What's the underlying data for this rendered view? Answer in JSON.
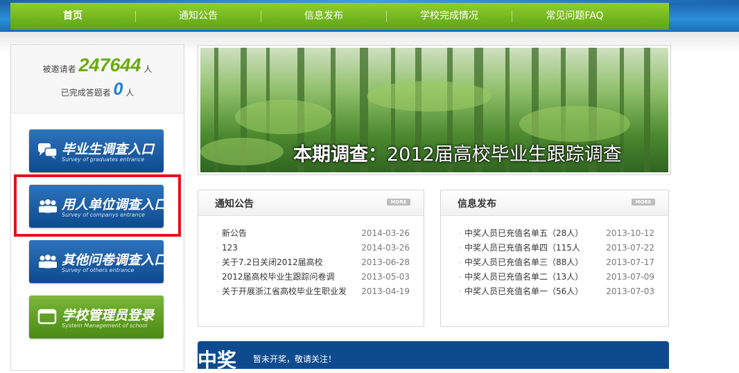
{
  "nav": {
    "items": [
      "首页",
      "通知公告",
      "信息发布",
      "学校完成情况",
      "常见问题FAQ"
    ],
    "active": "首页"
  },
  "stats": {
    "invited_label": "被邀请者",
    "invited_count": "247644",
    "invited_unit": "人",
    "completed_label": "已完成答题者",
    "completed_count": "0",
    "completed_unit": "人"
  },
  "entries": [
    {
      "title": "毕业生调查入口",
      "subtitle": "Survey of graduates entrance",
      "icon": "chat-bubbles-icon"
    },
    {
      "title": "用人单位调查入口",
      "subtitle": "Survey of companys entrance",
      "icon": "people-group-icon"
    },
    {
      "title": "其他问卷调查入口",
      "subtitle": "Survey of others entrance",
      "icon": "people-group-icon"
    },
    {
      "title": "学校管理员登录",
      "subtitle": "System Management of school",
      "icon": "window-icon"
    }
  ],
  "banner": {
    "prefix": "本期调查：",
    "title": "2012届高校毕业生跟踪调查"
  },
  "notice_panel": {
    "title": "通知公告",
    "more": "MORE",
    "items": [
      {
        "text": "新公告",
        "date": "2014-03-26"
      },
      {
        "text": "123",
        "date": "2014-03-26"
      },
      {
        "text": "关于7.2日关闭2012届高校",
        "date": "2013-06-28"
      },
      {
        "text": "2012届高校毕业生跟踪问卷调",
        "date": "2013-05-03"
      },
      {
        "text": "关于开展浙江省高校毕业生职业发",
        "date": "2013-04-19"
      }
    ]
  },
  "info_panel": {
    "title": "信息发布",
    "more": "MORE",
    "items": [
      {
        "text": "中奖人员已充值名单五（28人）",
        "date": "2013-10-12"
      },
      {
        "text": "中奖人员已充值名单四（115人",
        "date": "2013-07-22"
      },
      {
        "text": "中奖人员已充值名单三（88人）",
        "date": "2013-07-17"
      },
      {
        "text": "中奖人员已充值名单二（13人）",
        "date": "2013-07-09"
      },
      {
        "text": "中奖人员已充值名单一（56人）",
        "date": "2013-07-03"
      }
    ]
  },
  "prize": {
    "title": "中奖",
    "note": "暂未开奖，敬请关注！"
  },
  "colors": {
    "nav_green": "#6aaa12",
    "entry_blue": "#0d4a8e",
    "entry_green": "#4a8a12",
    "highlight_red": "#e8101a",
    "count_green": "#6aaa12",
    "count_blue": "#1f7fd0"
  }
}
